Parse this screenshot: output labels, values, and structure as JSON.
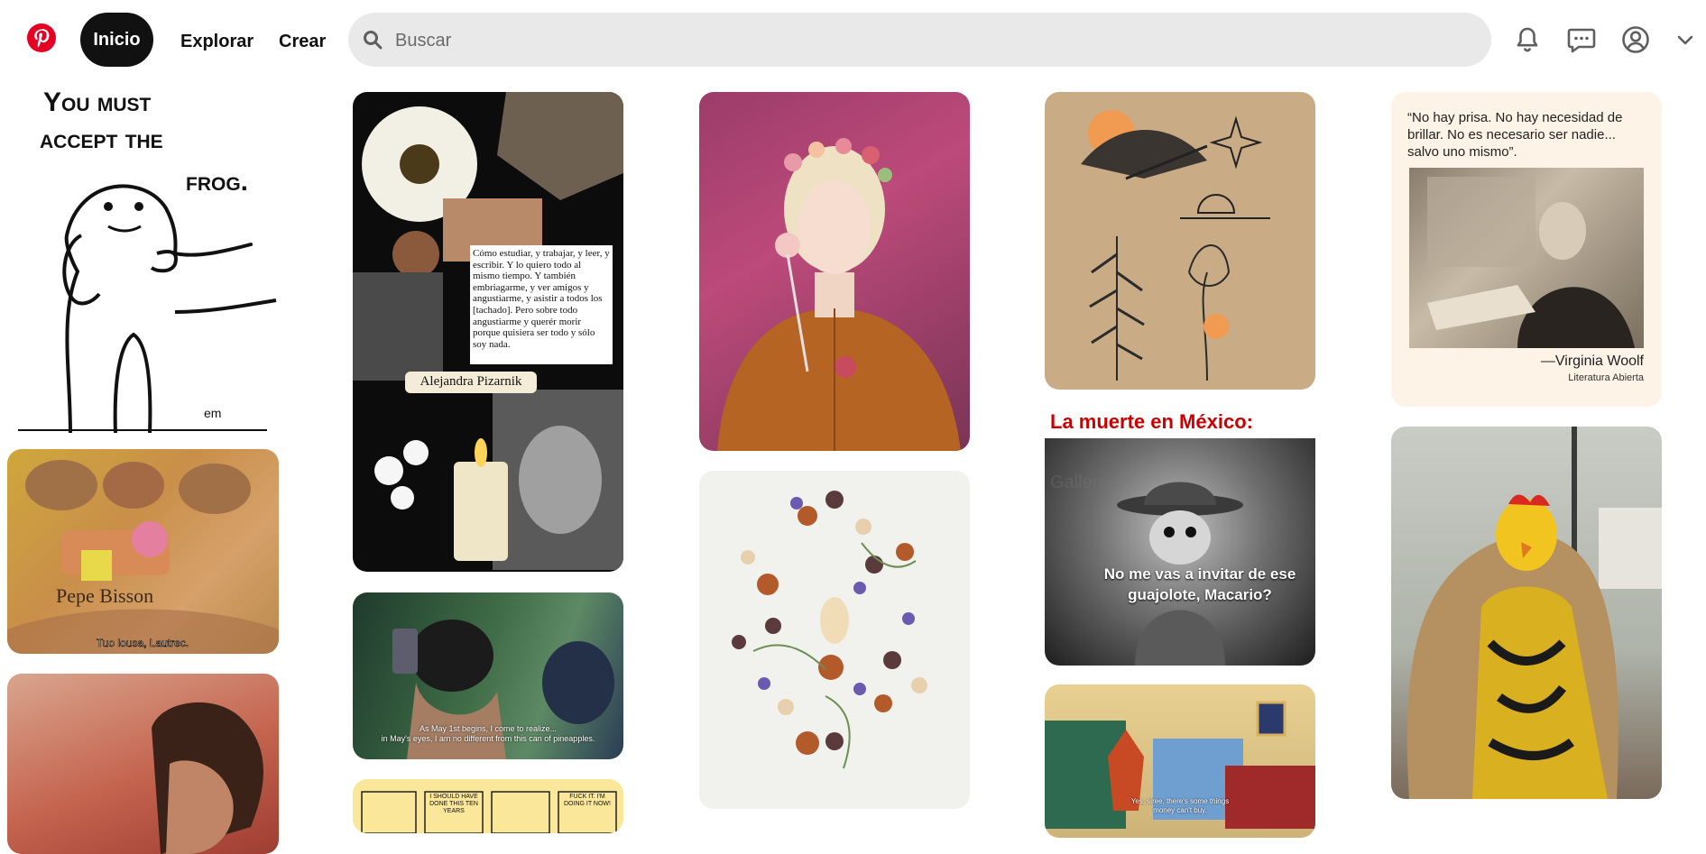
{
  "header": {
    "logo_label": "Pinterest",
    "nav": {
      "home": "Inicio",
      "explore": "Explorar",
      "create": "Crear"
    },
    "search": {
      "placeholder": "Buscar",
      "value": ""
    },
    "icons": [
      "bell-icon",
      "message-icon",
      "profile-icon",
      "chevron-down-icon"
    ]
  },
  "colors": {
    "brand": "#e60023",
    "active_nav_bg": "#111111",
    "search_bg": "#e9e9e9",
    "la_muerte_red": "#cc0000"
  },
  "pins": {
    "frog": {
      "line1": "You must",
      "line2": "accept the",
      "line3": "frog.",
      "sig": "em"
    },
    "spongebob": {
      "sub_caption": "Tuo lousa, Lautrec.",
      "poster_text": "Pepe Bisson"
    },
    "pizarnik": {
      "quote": "Cómo estudiar, y trabajar, y leer, y escribir. Y lo quiero todo al mismo tiempo. Y también embriagarme, y ver amigos y angustiarme, y asistir a todos los [tachado]. Pero sobre todo angustiarme y querér morir porque quisiera ser todo y sólo soy nada.",
      "author": "Alejandra Pizarnik"
    },
    "chungking": {
      "subtitle_1": "As May 1st begins, I come to realize...",
      "subtitle_2": "in May's eyes, I am no different from this can of pineapples."
    },
    "comic": {
      "panel_1": "I SHOULD HAVE DONE THIS TEN YEARS",
      "panel_2": "FUCK IT. I'M DOING IT NOW!"
    },
    "la_muerte": {
      "title": "La muerte en México:",
      "caption": "No me vas a invitar de ese guajolote, Macario?",
      "watermark": "Gallero"
    },
    "cartoon": {
      "subtitle_1": "Yes, siree, there's some things",
      "subtitle_2": "money can't buy."
    },
    "woolf": {
      "quote": "“No hay prisa. No hay necesidad de brillar. No es necesario ser nadie... salvo uno mismo”.",
      "author": "—Virginia Woolf",
      "source": "Literatura Abierta"
    }
  }
}
